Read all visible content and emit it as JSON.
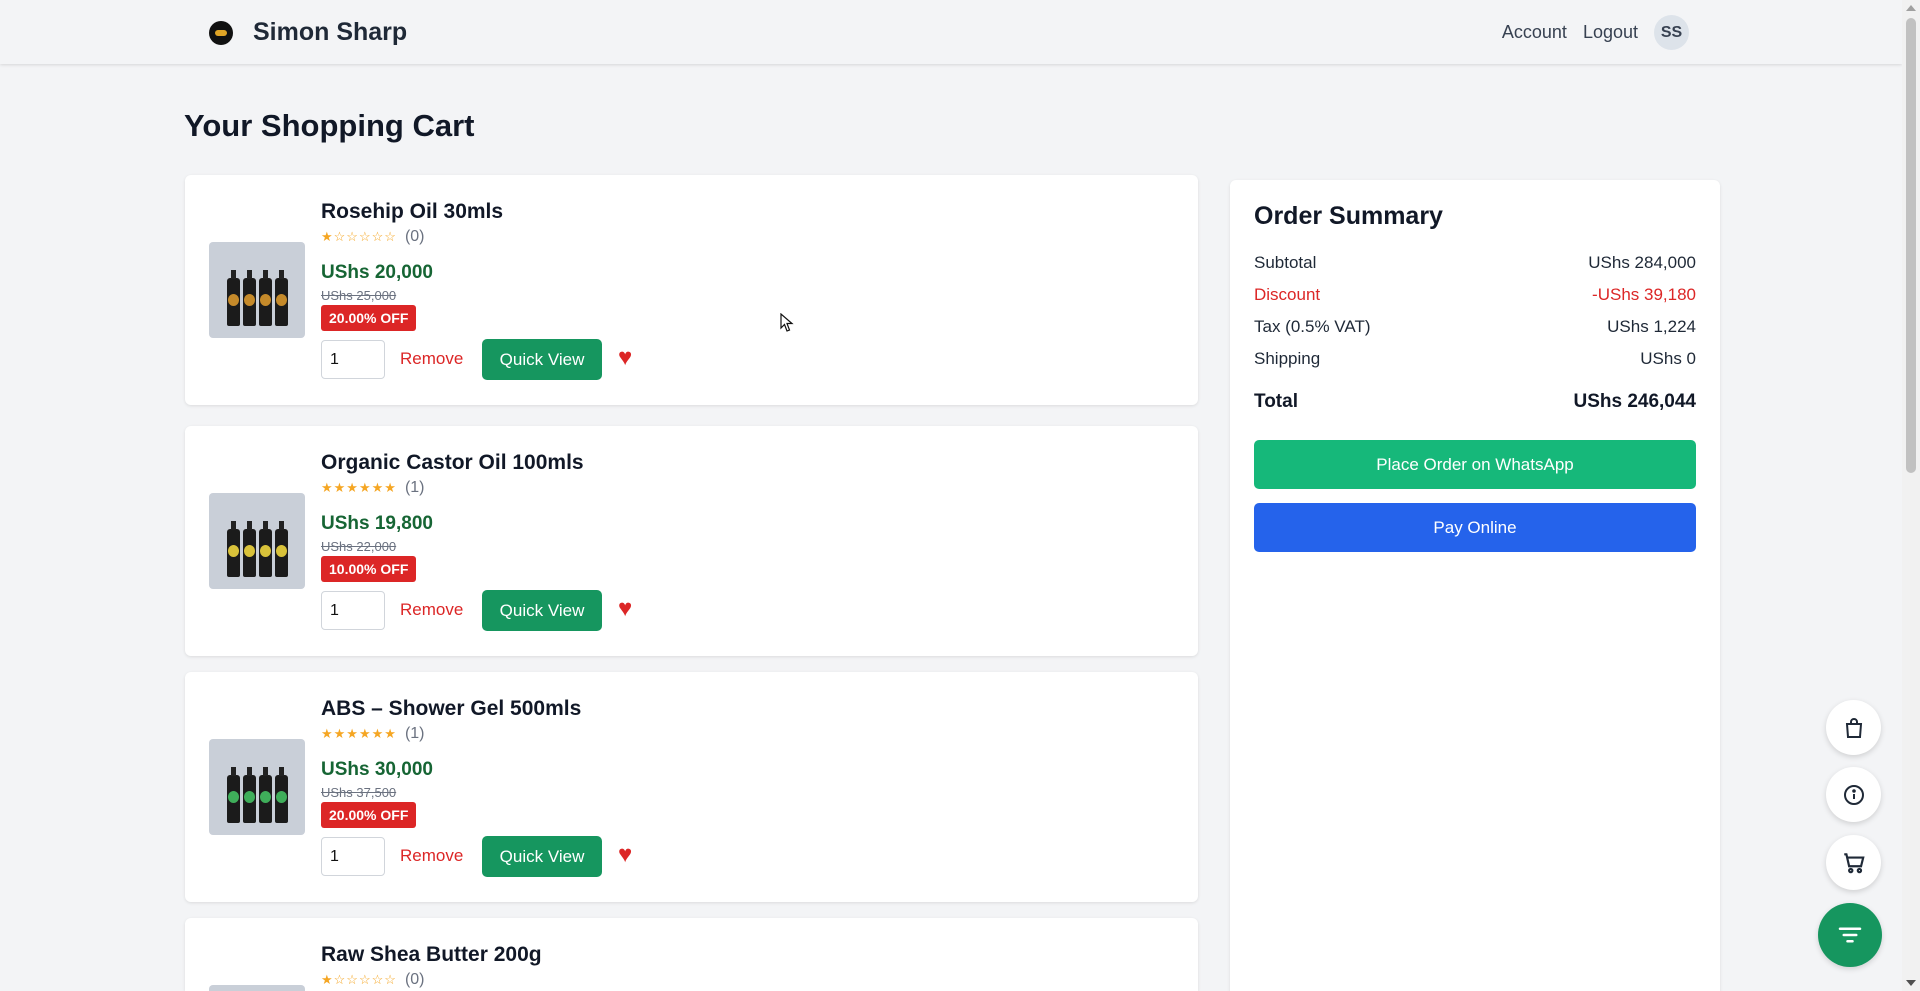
{
  "header": {
    "brand": "Simon Sharp",
    "nav": {
      "account": "Account",
      "logout": "Logout"
    },
    "avatar_initials": "SS"
  },
  "page_title": "Your Shopping Cart",
  "cart": {
    "items": [
      {
        "name": "Rosehip Oil 30mls",
        "stars": "★☆☆☆☆☆",
        "rating_count": "(0)",
        "price": "UShs 20,000",
        "old_price": "UShs 25,000",
        "discount": "20.00% OFF",
        "qty": "1",
        "remove_label": "Remove",
        "quick_view_label": "Quick View"
      },
      {
        "name": "Organic Castor Oil 100mls",
        "stars": "★★★★★★",
        "rating_count": "(1)",
        "price": "UShs 19,800",
        "old_price": "UShs 22,000",
        "discount": "10.00% OFF",
        "qty": "1",
        "remove_label": "Remove",
        "quick_view_label": "Quick View"
      },
      {
        "name": "ABS – Shower Gel 500mls",
        "stars": "★★★★★★",
        "rating_count": "(1)",
        "price": "UShs 30,000",
        "old_price": "UShs 37,500",
        "discount": "20.00% OFF",
        "qty": "1",
        "remove_label": "Remove",
        "quick_view_label": "Quick View"
      },
      {
        "name": "Raw Shea Butter 200g",
        "stars": "★☆☆☆☆☆",
        "rating_count": "(0)"
      }
    ]
  },
  "summary": {
    "title": "Order Summary",
    "rows": [
      {
        "label": "Subtotal",
        "value": "UShs 284,000"
      },
      {
        "label": "Discount",
        "value": "-UShs 39,180"
      },
      {
        "label": "Tax (0.5% VAT)",
        "value": "UShs 1,224"
      },
      {
        "label": "Shipping",
        "value": "UShs 0"
      }
    ],
    "total": {
      "label": "Total",
      "value": "UShs 246,044"
    },
    "whatsapp_label": "Place Order on WhatsApp",
    "pay_label": "Pay Online"
  },
  "floating_buttons": [
    "shopping-bag-icon",
    "info-icon",
    "cart-icon",
    "menu-icon"
  ],
  "colors": {
    "primary_green": "#16965f",
    "whatsapp_green": "#16b87a",
    "pay_blue": "#2563eb",
    "discount_red": "#dc2626",
    "price_green": "#166534"
  }
}
